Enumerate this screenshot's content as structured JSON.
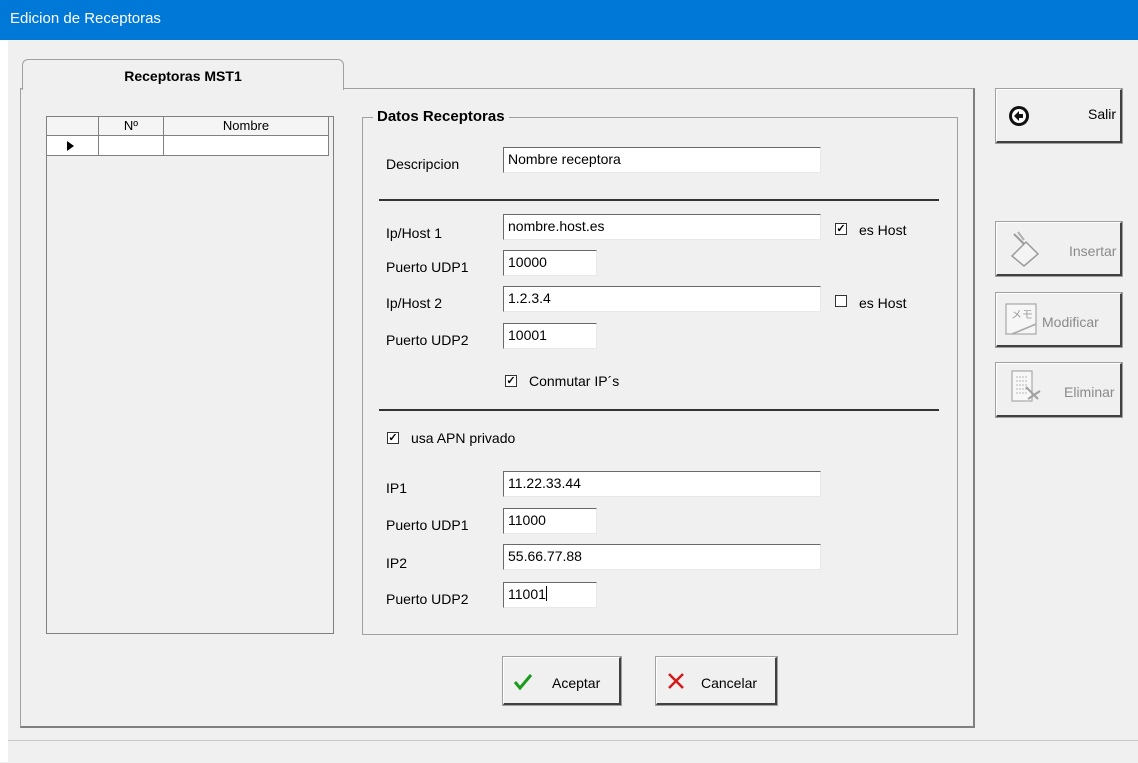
{
  "window": {
    "title": "Edicion de Receptoras"
  },
  "tab": {
    "label": "Receptoras MST1"
  },
  "grid": {
    "columns": [
      "Nº",
      "Nombre"
    ],
    "rows": [
      {
        "num": "",
        "nombre": ""
      }
    ]
  },
  "form": {
    "group_title": "Datos Receptoras",
    "descripcion_label": "Descripcion",
    "descripcion_value": "Nombre receptora",
    "iphost1_label": "Ip/Host 1",
    "iphost1_value": "nombre.host.es",
    "es_host1_label": "es Host",
    "es_host1_checked": true,
    "puerto_udp1_label": "Puerto UDP1",
    "puerto_udp1_value": "10000",
    "iphost2_label": "Ip/Host 2",
    "iphost2_value": "1.2.3.4",
    "es_host2_label": "es Host",
    "es_host2_checked": false,
    "puerto_udp2_label": "Puerto UDP2",
    "puerto_udp2_value": "10001",
    "conmutar_label": "Conmutar IP´s",
    "conmutar_checked": true,
    "apn_label": "usa APN privado",
    "apn_checked": true,
    "ip1_label": "IP1",
    "ip1_value": "11.22.33.44",
    "apn_udp1_label": "Puerto UDP1",
    "apn_udp1_value": "11000",
    "ip2_label": "IP2",
    "ip2_value": "55.66.77.88",
    "apn_udp2_label": "Puerto UDP2",
    "apn_udp2_value": "11001"
  },
  "buttons": {
    "aceptar": "Aceptar",
    "cancelar": "Cancelar",
    "salir": "Salir",
    "insertar": "Insertar",
    "modificar": "Modificar",
    "eliminar": "Eliminar"
  },
  "colors": {
    "titlebar": "#0078d7",
    "check_green": "#1a9c1a",
    "cancel_red": "#d41a1a"
  }
}
